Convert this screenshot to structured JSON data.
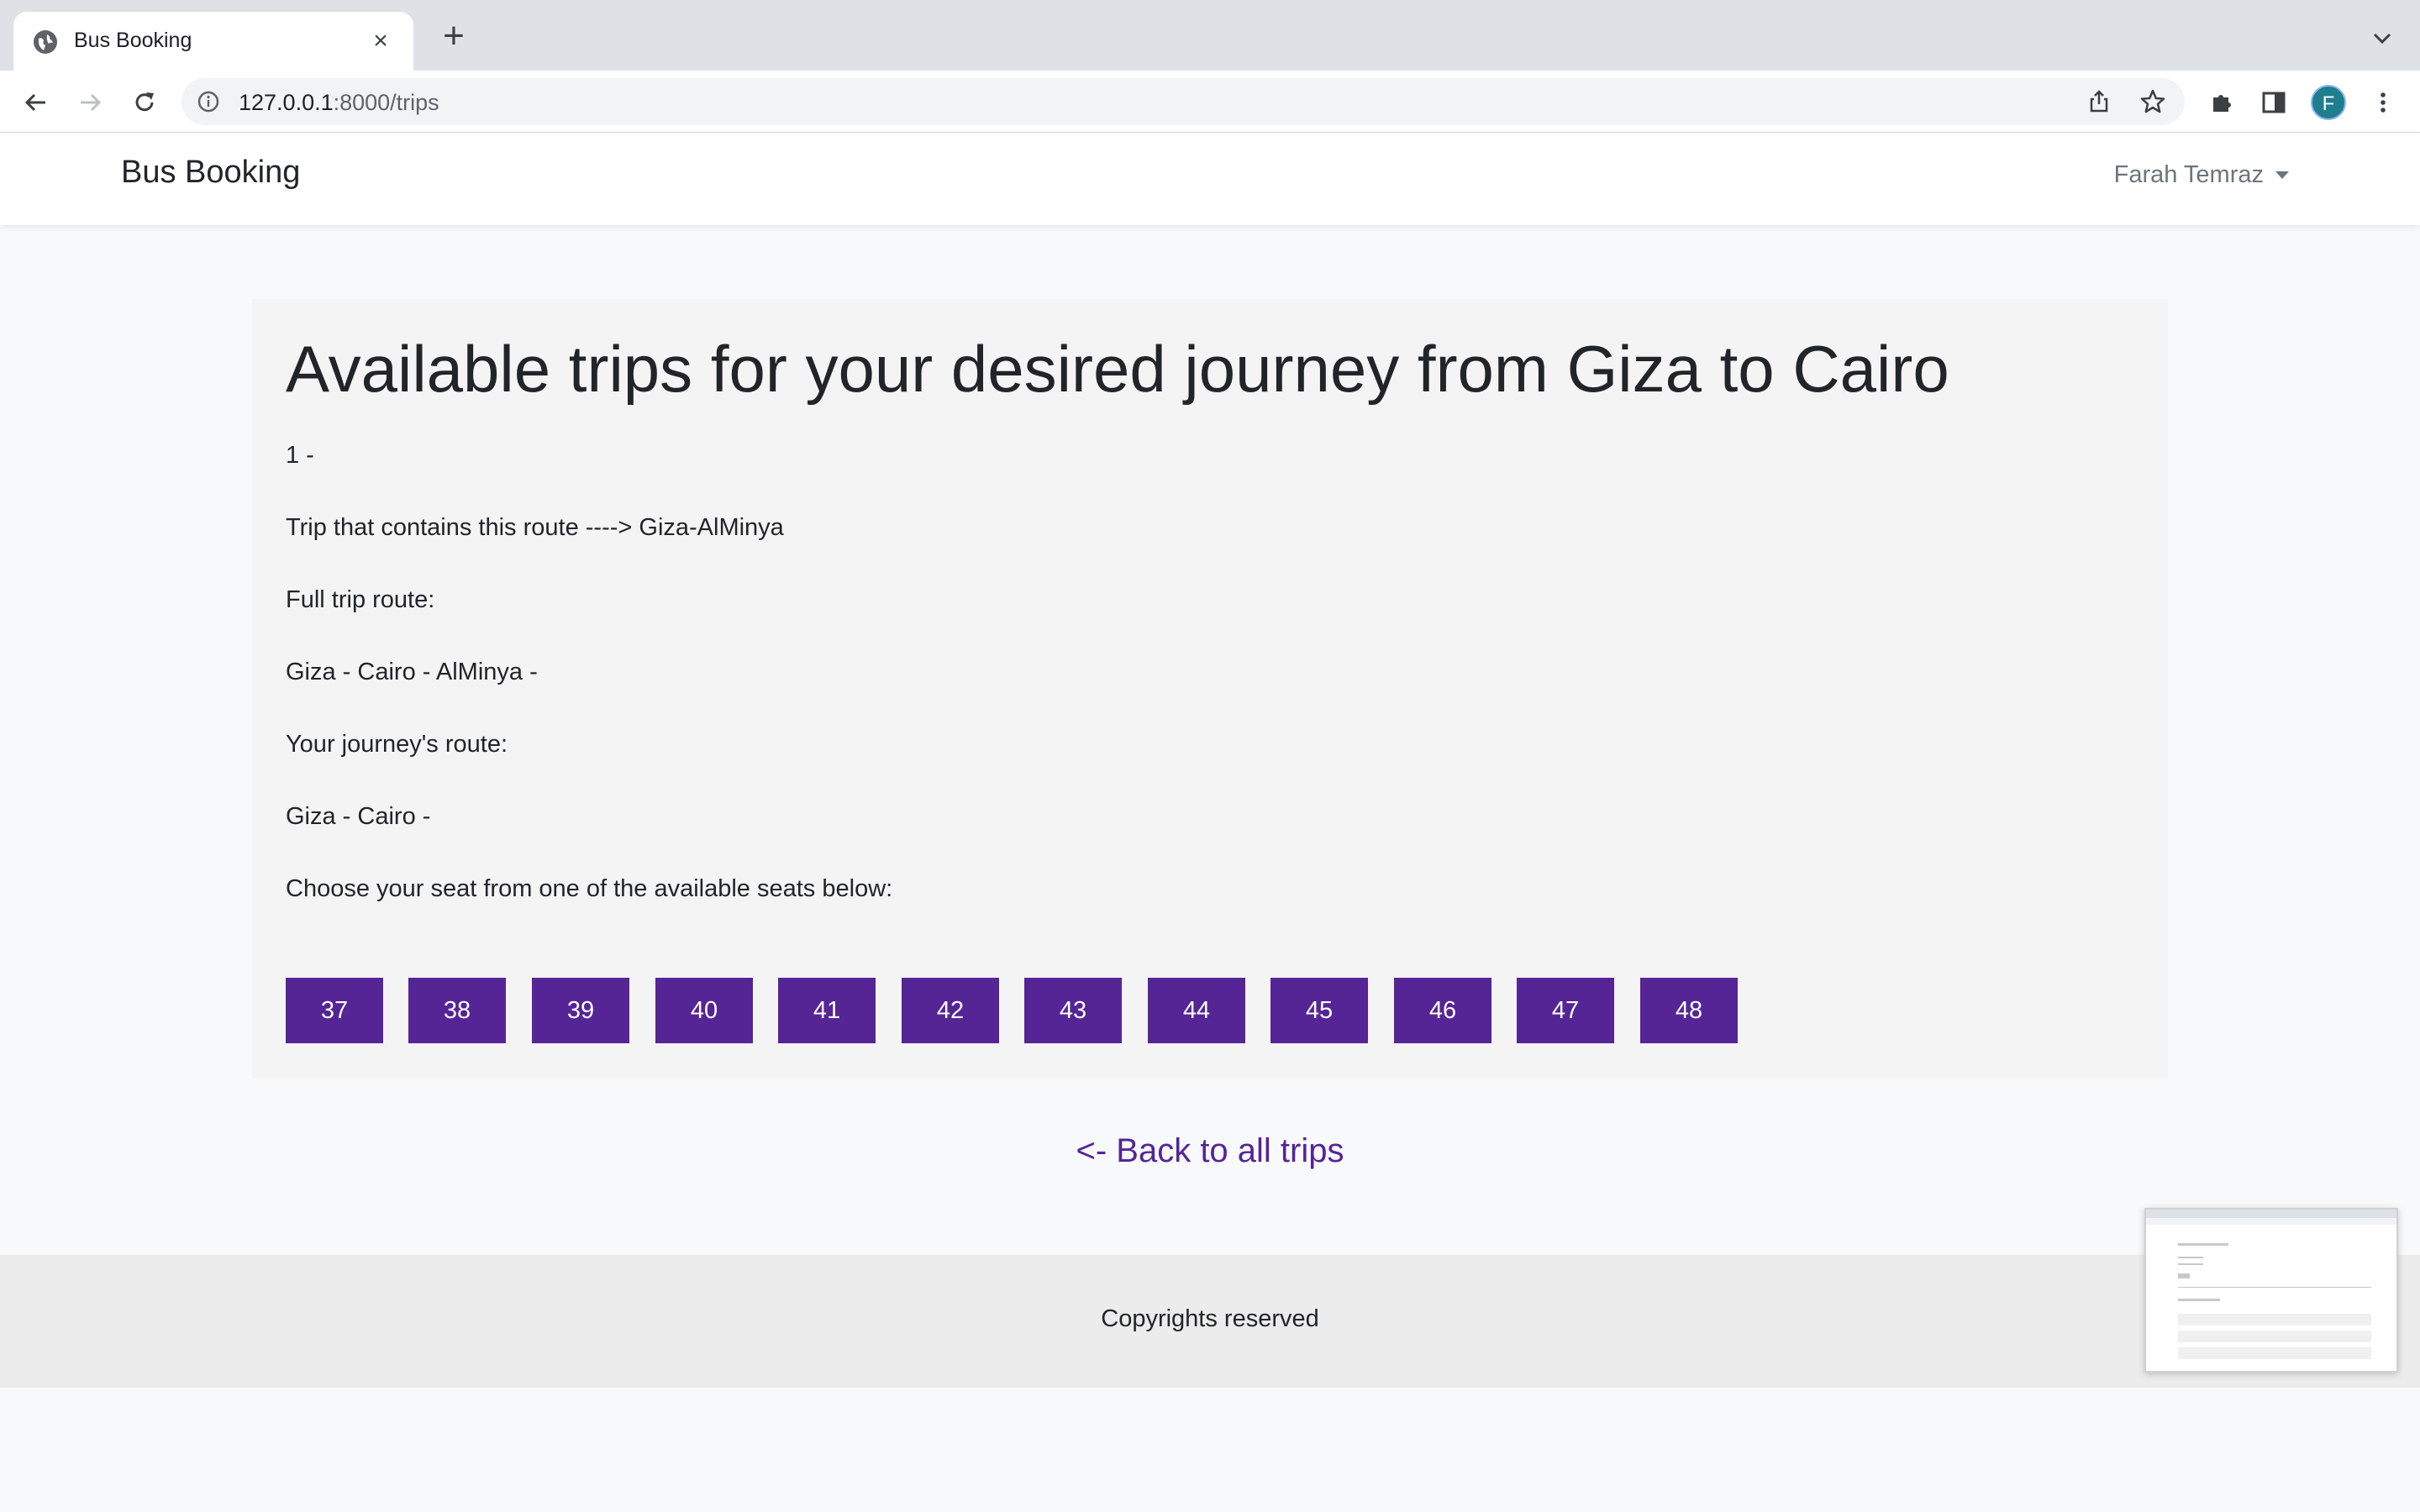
{
  "browser": {
    "tab_title": "Bus Booking",
    "tab_close": "×",
    "new_tab": "+",
    "url_host": "127.0.0.1",
    "url_path": ":8000/trips",
    "profile_initial": "F"
  },
  "navbar": {
    "brand": "Bus Booking",
    "user_name": "Farah Temraz"
  },
  "main": {
    "title": "Available trips for your desired journey from Giza to Cairo",
    "trip_number": "1 -",
    "trip_contains": "Trip that contains this route ----> Giza-AlMinya",
    "full_route_label": "Full trip route:",
    "full_route": "Giza - Cairo - AlMinya -",
    "journey_route_label": "Your journey's route:",
    "journey_route": "Giza - Cairo -",
    "choose_seat": "Choose your seat from one of the available seats below:",
    "seats": [
      "37",
      "38",
      "39",
      "40",
      "41",
      "42",
      "43",
      "44",
      "45",
      "46",
      "47",
      "48"
    ],
    "back_link": "<- Back to all trips"
  },
  "footer": {
    "text": "Copyrights reserved"
  },
  "colors": {
    "accent": "#552596",
    "avatar": "#1e7e8c"
  }
}
